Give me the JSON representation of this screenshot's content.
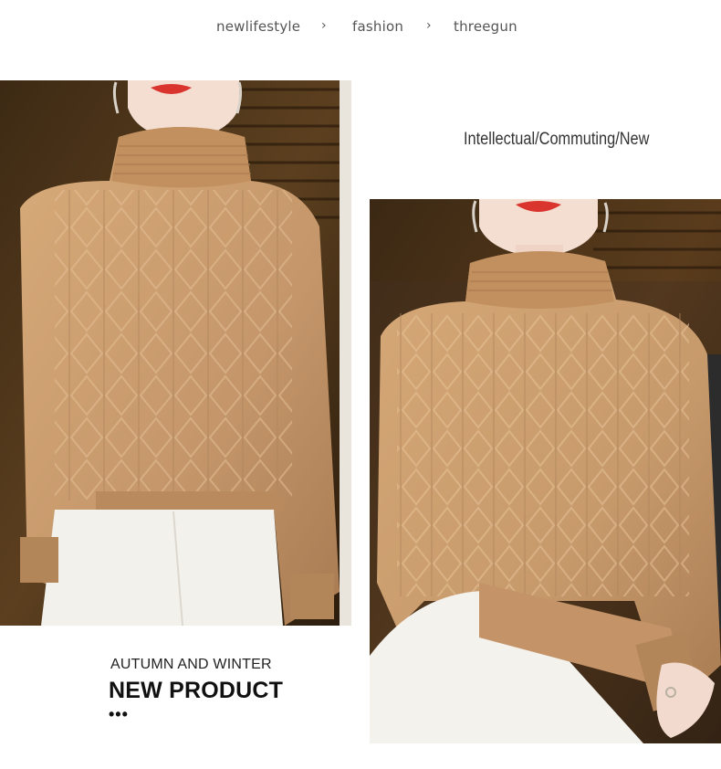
{
  "breadcrumb": {
    "items": [
      "newlifestyle",
      "fashion",
      "threegun"
    ],
    "separator": "›"
  },
  "tagline": "Intellectual/Commuting/New",
  "promo": {
    "season": "AUTUMN AND WINTER",
    "headline": "NEW PRODUCT",
    "dots": "•••"
  },
  "colors": {
    "sweater": "#c79a6c",
    "background_wall": "#5a3c1c",
    "pants": "#f1efea"
  }
}
